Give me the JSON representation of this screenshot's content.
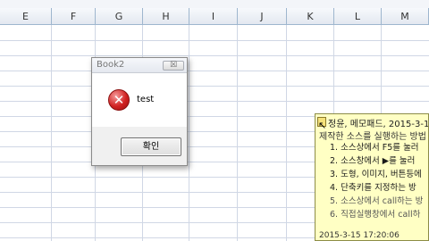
{
  "columns": [
    "E",
    "F",
    "G",
    "H",
    "I",
    "J",
    "K",
    "L",
    "M"
  ],
  "dialog": {
    "title": "Book2",
    "close_label": "☒",
    "error_symbol": "✕",
    "message": "test",
    "ok_label": "확인"
  },
  "note": {
    "title": "정윤, 메모패드, 2015-3-1",
    "subtitle": "제작한 소스를 실행하는 방법",
    "items": [
      {
        "text": "1. 소스상에서 F5를 눌러",
        "color": "#1a1a1a"
      },
      {
        "text": "2. 소스창에서 ▶를 눌러",
        "color": "#1a1a1a"
      },
      {
        "text": "3. 도형, 이미지, 버튼등에",
        "color": "#1a1a1a"
      },
      {
        "text": "4. 단축키를 지정하는 방",
        "color": "#1a1a1a"
      },
      {
        "text": "5. 소스상에서 call하는 방",
        "color": "#555555"
      },
      {
        "text": "6. 직접실행창에서 call하",
        "color": "#555555"
      }
    ],
    "footer": "2015-3-15 17:20:06"
  }
}
